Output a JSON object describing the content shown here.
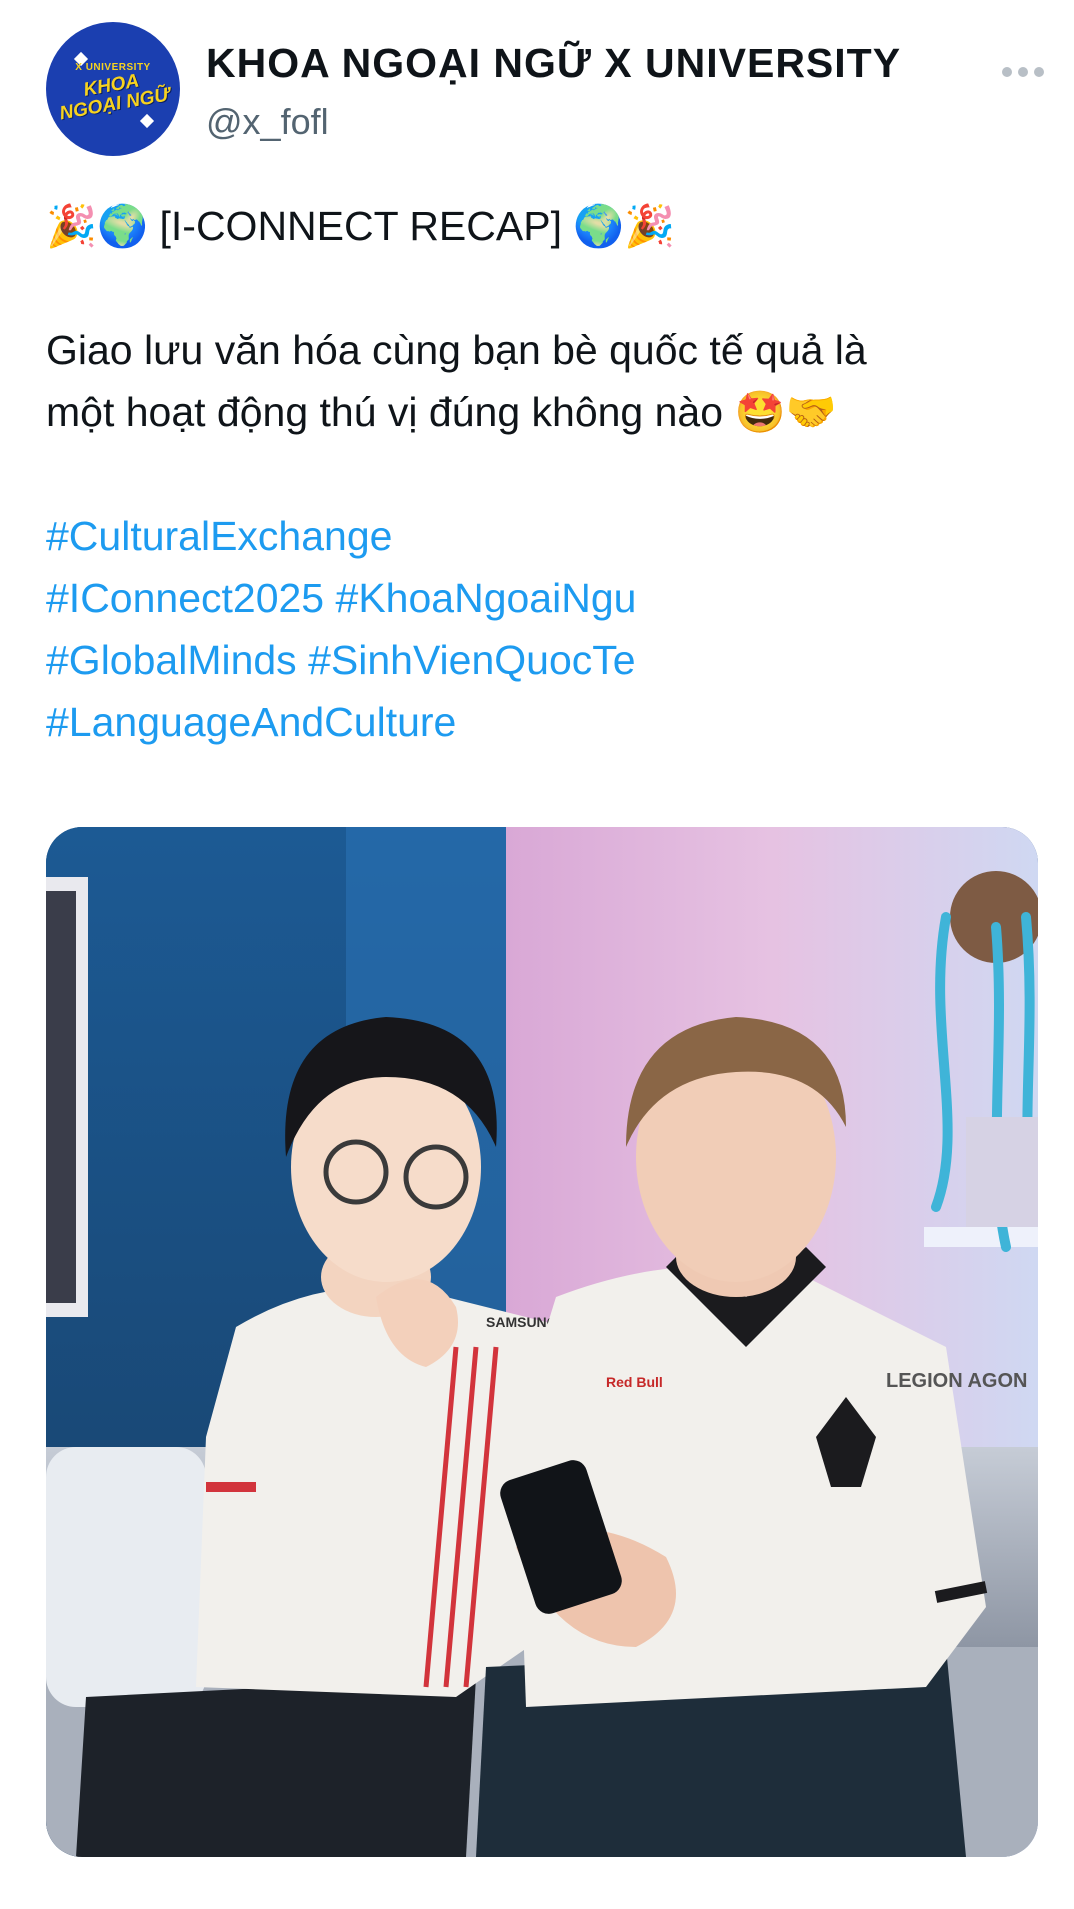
{
  "account": {
    "display_name": "KHOA NGOẠI NGỮ X UNIVERSITY",
    "handle": "@x_fofl",
    "avatar": {
      "top_text": "X UNIVERSITY",
      "line1": "KHOA",
      "line2": "NGOẠI NGỮ",
      "background": "#1b3fb0",
      "text_color": "#f6d21f"
    }
  },
  "menu": {
    "icon": "more-dots-icon"
  },
  "post": {
    "title_emoji_left": "🎉🌍",
    "title": "[I-CONNECT RECAP]",
    "title_emoji_right": "🌍🎉",
    "body_line1": "Giao lưu văn hóa cùng bạn bè quốc tế quả là",
    "body_line2": "một hoạt động thú vị đúng không nào",
    "body_emoji": "🤩🤝",
    "hashtags": [
      "#CulturalExchange",
      "#IConnect2025",
      "#KhoaNgoaiNgu",
      "#GlobalMinds",
      "#SinhVienQuocTe",
      "#LanguageAndCulture"
    ]
  },
  "media": {
    "kind": "photo",
    "left_jersey_text": "SAMSUNG Odyssey",
    "right_jersey_text": "Red Bull",
    "right_sleeve_text": "LEGION AGON",
    "colors": {
      "wall_blue": "#1f4f86",
      "wall_pink": "#e8b8dc",
      "wall_light": "#cfd8f0",
      "jersey_white": "#f2f0ec",
      "hashtag_blue": "#1d9bf0",
      "handle_gray": "#536471"
    }
  }
}
